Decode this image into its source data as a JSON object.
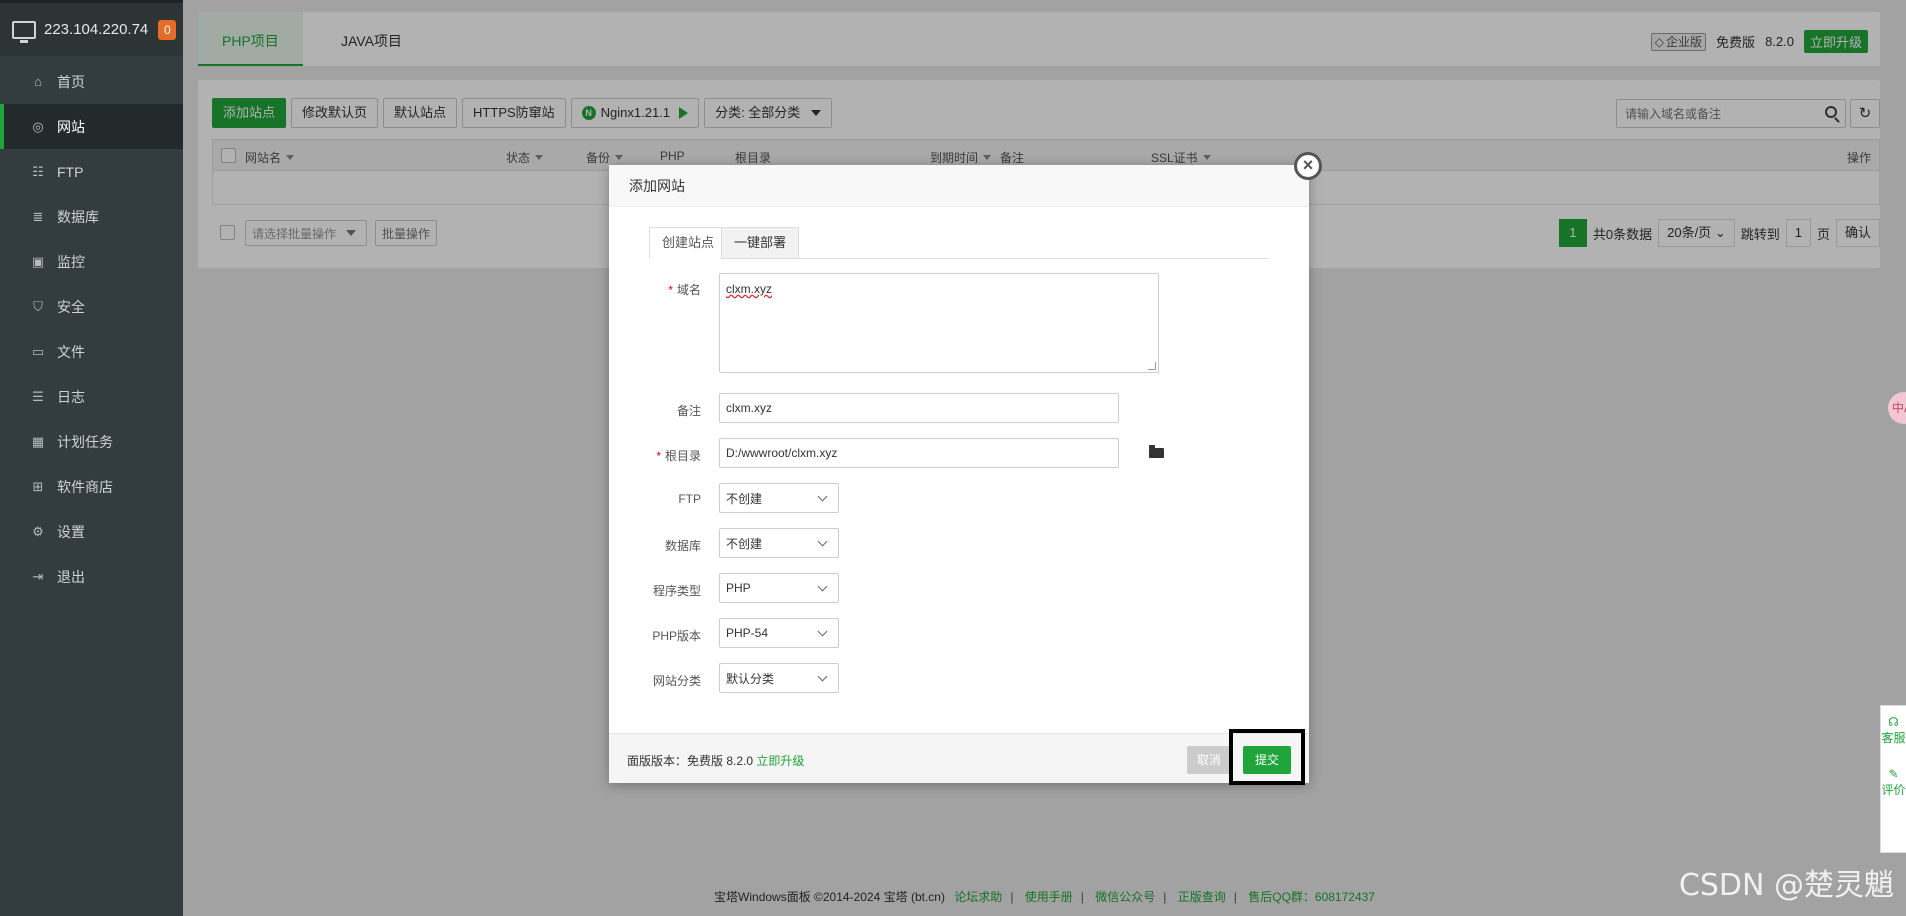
{
  "sidebar": {
    "ip": "223.104.220.74",
    "badge": "0",
    "items": [
      {
        "label": "首页",
        "icon": "home-icon"
      },
      {
        "label": "网站",
        "icon": "globe-icon",
        "active": true
      },
      {
        "label": "FTP",
        "icon": "ftp-icon"
      },
      {
        "label": "数据库",
        "icon": "database-icon"
      },
      {
        "label": "监控",
        "icon": "monitor-icon"
      },
      {
        "label": "安全",
        "icon": "shield-icon"
      },
      {
        "label": "文件",
        "icon": "folder-icon"
      },
      {
        "label": "日志",
        "icon": "log-icon"
      },
      {
        "label": "计划任务",
        "icon": "calendar-icon"
      },
      {
        "label": "软件商店",
        "icon": "apps-icon"
      },
      {
        "label": "设置",
        "icon": "gear-icon"
      },
      {
        "label": "退出",
        "icon": "logout-icon"
      }
    ]
  },
  "topbar": {
    "tabs": [
      "PHP项目",
      "JAVA项目"
    ],
    "enterprise": "企业版",
    "edition": "免费版",
    "version": "8.2.0",
    "upgrade": "立即升级"
  },
  "toolbar": {
    "add_site": "添加站点",
    "edit_default_page": "修改默认页",
    "default_site": "默认站点",
    "https_guard": "HTTPS防窜站",
    "nginx": "Nginx1.21.1",
    "category": "分类: 全部分类"
  },
  "search": {
    "placeholder": "请输入域名或备注"
  },
  "table": {
    "headers": [
      "网站名",
      "状态",
      "备份",
      "PHP",
      "根目录",
      "到期时间",
      "备注",
      "SSL证书",
      "操作"
    ]
  },
  "batch": {
    "select_placeholder": "请选择批量操作",
    "button": "批量操作"
  },
  "pager": {
    "page": "1",
    "total": "共0条数据",
    "per_page": "20条/页",
    "goto": "跳转到",
    "goto_page": "1",
    "page_unit": "页",
    "confirm": "确认"
  },
  "modal": {
    "title": "添加网站",
    "tabs": [
      "创建站点",
      "一键部署"
    ],
    "fields": {
      "domain_label": "域名",
      "domain_value": "clxm.xyz",
      "remark_label": "备注",
      "remark_value": "clxm.xyz",
      "root_label": "根目录",
      "root_value": "D:/wwwroot/clxm.xyz",
      "ftp_label": "FTP",
      "ftp_value": "不创建",
      "db_label": "数据库",
      "db_value": "不创建",
      "type_label": "程序类型",
      "type_value": "PHP",
      "php_label": "PHP版本",
      "php_value": "PHP-54",
      "cat_label": "网站分类",
      "cat_value": "默认分类"
    },
    "footer": {
      "version_text": "面版版本：免费版 8.2.0",
      "upgrade": "立即升级",
      "cancel": "取消",
      "submit": "提交"
    }
  },
  "footer": {
    "copyright": "宝塔Windows面板 ©2014-2024 宝塔 (bt.cn)",
    "links": [
      "论坛求助",
      "使用手册",
      "微信公众号",
      "正版查询",
      "售后QQ群：608172437"
    ]
  },
  "watermark": "CSDN @楚灵魈",
  "side_widgets": {
    "float": "中A",
    "help": "客服",
    "review": "评价"
  },
  "colors": {
    "accent": "#20a53a",
    "sidebar": "#333c3e",
    "badge": "#e46b28"
  }
}
